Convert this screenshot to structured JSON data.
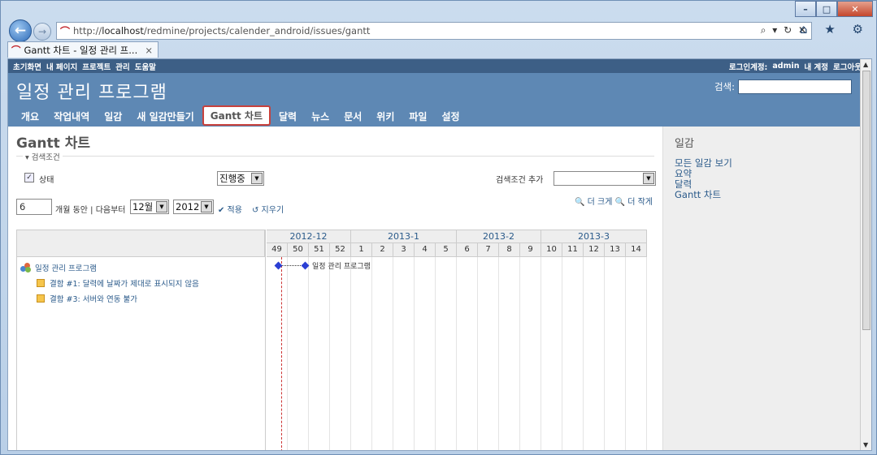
{
  "browser": {
    "url_prefix": "http://",
    "url_host": "localhost",
    "url_path": "/redmine/projects/calender_android/issues/gantt",
    "address_tools": "⌕ ▾ ↻ ✕",
    "tab_title": "Gantt 차트 - 일정 관리 프...",
    "tab_close": "×",
    "toolbar_icons": "⌂ ★ ⚙"
  },
  "topmenu": {
    "left": [
      "초기화면",
      "내 페이지",
      "프로젝트",
      "관리",
      "도움말"
    ],
    "login_label": "로그인계정:",
    "login_user": "admin",
    "my_account": "내 계정",
    "logout": "로그아웃"
  },
  "header": {
    "title": "일정 관리 프로그램",
    "search_label": "검색:",
    "search_value": ""
  },
  "mainmenu": [
    "개요",
    "작업내역",
    "일감",
    "새 일감만들기",
    "Gantt 차트",
    "달력",
    "뉴스",
    "문서",
    "위키",
    "파일",
    "설정"
  ],
  "mainmenu_selected": "Gantt 차트",
  "content": {
    "title": "Gantt 차트",
    "filter_legend": "▾ 검색조건",
    "status_label": "상태",
    "status_checked": "✓",
    "status_value": "진행중",
    "add_filter_label": "검색조건 추가",
    "add_filter_value": "",
    "months_value": "6",
    "months_text": "개월 동안 | 다음부터",
    "month_select": "12월",
    "year_select": "2012",
    "apply": "✔ 적용",
    "clear": "↺ 지우기",
    "zoom_in": "더 크게",
    "zoom_out": "더 작게"
  },
  "gantt": {
    "months": [
      {
        "label": "2012-12",
        "weeks": 4
      },
      {
        "label": "2013-1",
        "weeks": 5
      },
      {
        "label": "2013-2",
        "weeks": 4
      },
      {
        "label": "2013-3",
        "weeks": 5
      }
    ],
    "weeks": [
      "49",
      "50",
      "51",
      "52",
      "1",
      "2",
      "3",
      "4",
      "5",
      "6",
      "7",
      "8",
      "9",
      "10",
      "11",
      "12",
      "13",
      "14"
    ],
    "project": "일정 관리 프로그램",
    "issues": [
      "결함 #1: 달력에 날짜가 제대로 표시되지 않음",
      "결함 #3: 서버와 연동 불가"
    ],
    "bar_label": "일정 관리 프로그램"
  },
  "sidebar": {
    "title": "일감",
    "links": [
      "모든 일감 보기",
      "요약",
      "달력",
      "Gantt 차트"
    ]
  },
  "colors": {
    "header": "#5e88b4",
    "topmenu": "#3d5f86",
    "selected_border": "#c8413c",
    "milestone": "#2b3fd4",
    "today_line": "#cc3333"
  }
}
